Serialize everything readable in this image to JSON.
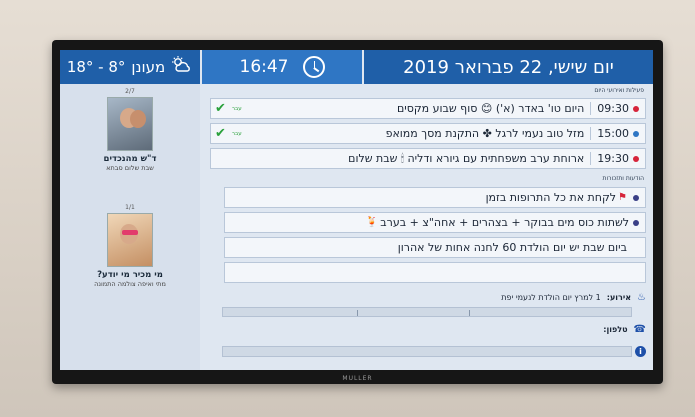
{
  "header": {
    "weather": {
      "icon": "partly-cloudy-icon",
      "label": "מעונן",
      "temps": "18° - 8°"
    },
    "time": "16:47",
    "date": "יום שישי, 22 פברואר 2019"
  },
  "sidebar": {
    "cards": [
      {
        "counter": "2/7",
        "title": "ד\"ש מהנכדים",
        "subtitle": "שבת שלום סבתא"
      },
      {
        "counter": "1/1",
        "title": "מי מכיר מי יודע?",
        "subtitle": "מתי ואיפה צולמה התמונה"
      }
    ]
  },
  "events": {
    "section_title": "פעילות ואירועי היום",
    "items": [
      {
        "time": "09:30",
        "text": "היום טו' באדר (א') 😊 סוף שבוע מקסים",
        "dot_color": "#d6243a",
        "done": "עבר"
      },
      {
        "time": "15:00",
        "text": "מזל טוב נעמי לרגל ✤ התקנת מסך ממואפ",
        "dot_color": "#2f76c4",
        "done": "עבר"
      },
      {
        "time": "19:30",
        "text": "ארוחת ערב משפחתית עם גיורא ודליה 🕯 שבת שלום",
        "dot_color": "#d6243a",
        "done": ""
      }
    ]
  },
  "reminders": {
    "section_title": "הודעות ותזכורות",
    "items": [
      {
        "text": "לקחת את כל התרופות בזמן",
        "icon": "flag-icon",
        "dot_color": "#3a3f86"
      },
      {
        "text": "לשתות כוס מים בבוקר + בצהרים + אחה\"צ + בערב",
        "icon": "drink-icon",
        "dot_color": "#3a3f86"
      },
      {
        "text": "ביום שבת יש יום הולדת 60 לחנה אחות של אהרון",
        "icon": "",
        "dot_color": ""
      },
      {
        "text": "",
        "icon": "",
        "dot_color": ""
      }
    ]
  },
  "info": {
    "event_label": "אירוע:",
    "event_value": "1 למרץ יום הולדת לנעמי יפת",
    "phone_label": "טלפון:",
    "alert_icon": "info-icon"
  },
  "brand": "MULLER"
}
